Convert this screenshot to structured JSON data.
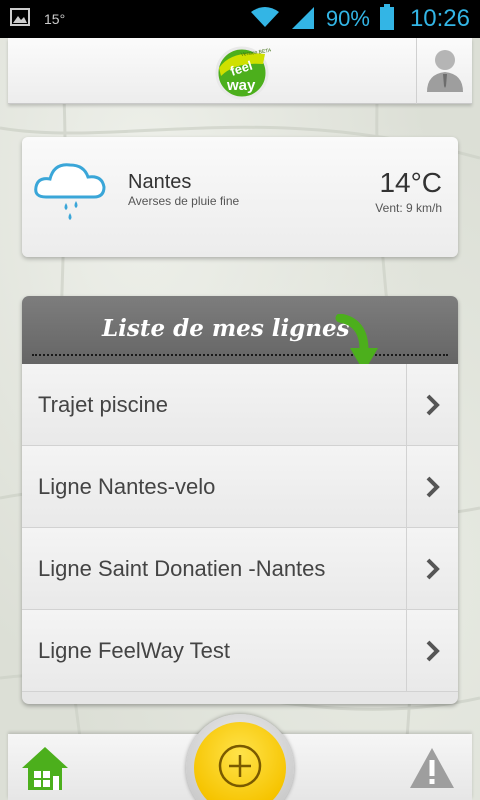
{
  "status_bar": {
    "temperature": "15°",
    "battery_percent": "90%",
    "time": "10:26"
  },
  "header": {
    "logo_text": "feel way",
    "logo_small": "Version BETA"
  },
  "weather": {
    "city": "Nantes",
    "description": "Averses de pluie fine",
    "temperature": "14°C",
    "wind": "Vent: 9 km/h",
    "icon": "rain-cloud-icon"
  },
  "lines": {
    "title": "Liste de mes lignes",
    "items": [
      {
        "label": "Trajet piscine"
      },
      {
        "label": "Ligne Nantes-velo"
      },
      {
        "label": "Ligne Saint Donatien -Nantes"
      },
      {
        "label": "Ligne FeelWay Test"
      }
    ]
  },
  "bottom_bar": {
    "home_icon": "home-icon",
    "add_icon": "plus-icon",
    "warning_icon": "warning-icon"
  },
  "colors": {
    "accent_blue": "#33b5e5",
    "brand_green": "#4caf1c",
    "add_yellow": "#f6c400",
    "header_gray": "#6f6f6f"
  }
}
